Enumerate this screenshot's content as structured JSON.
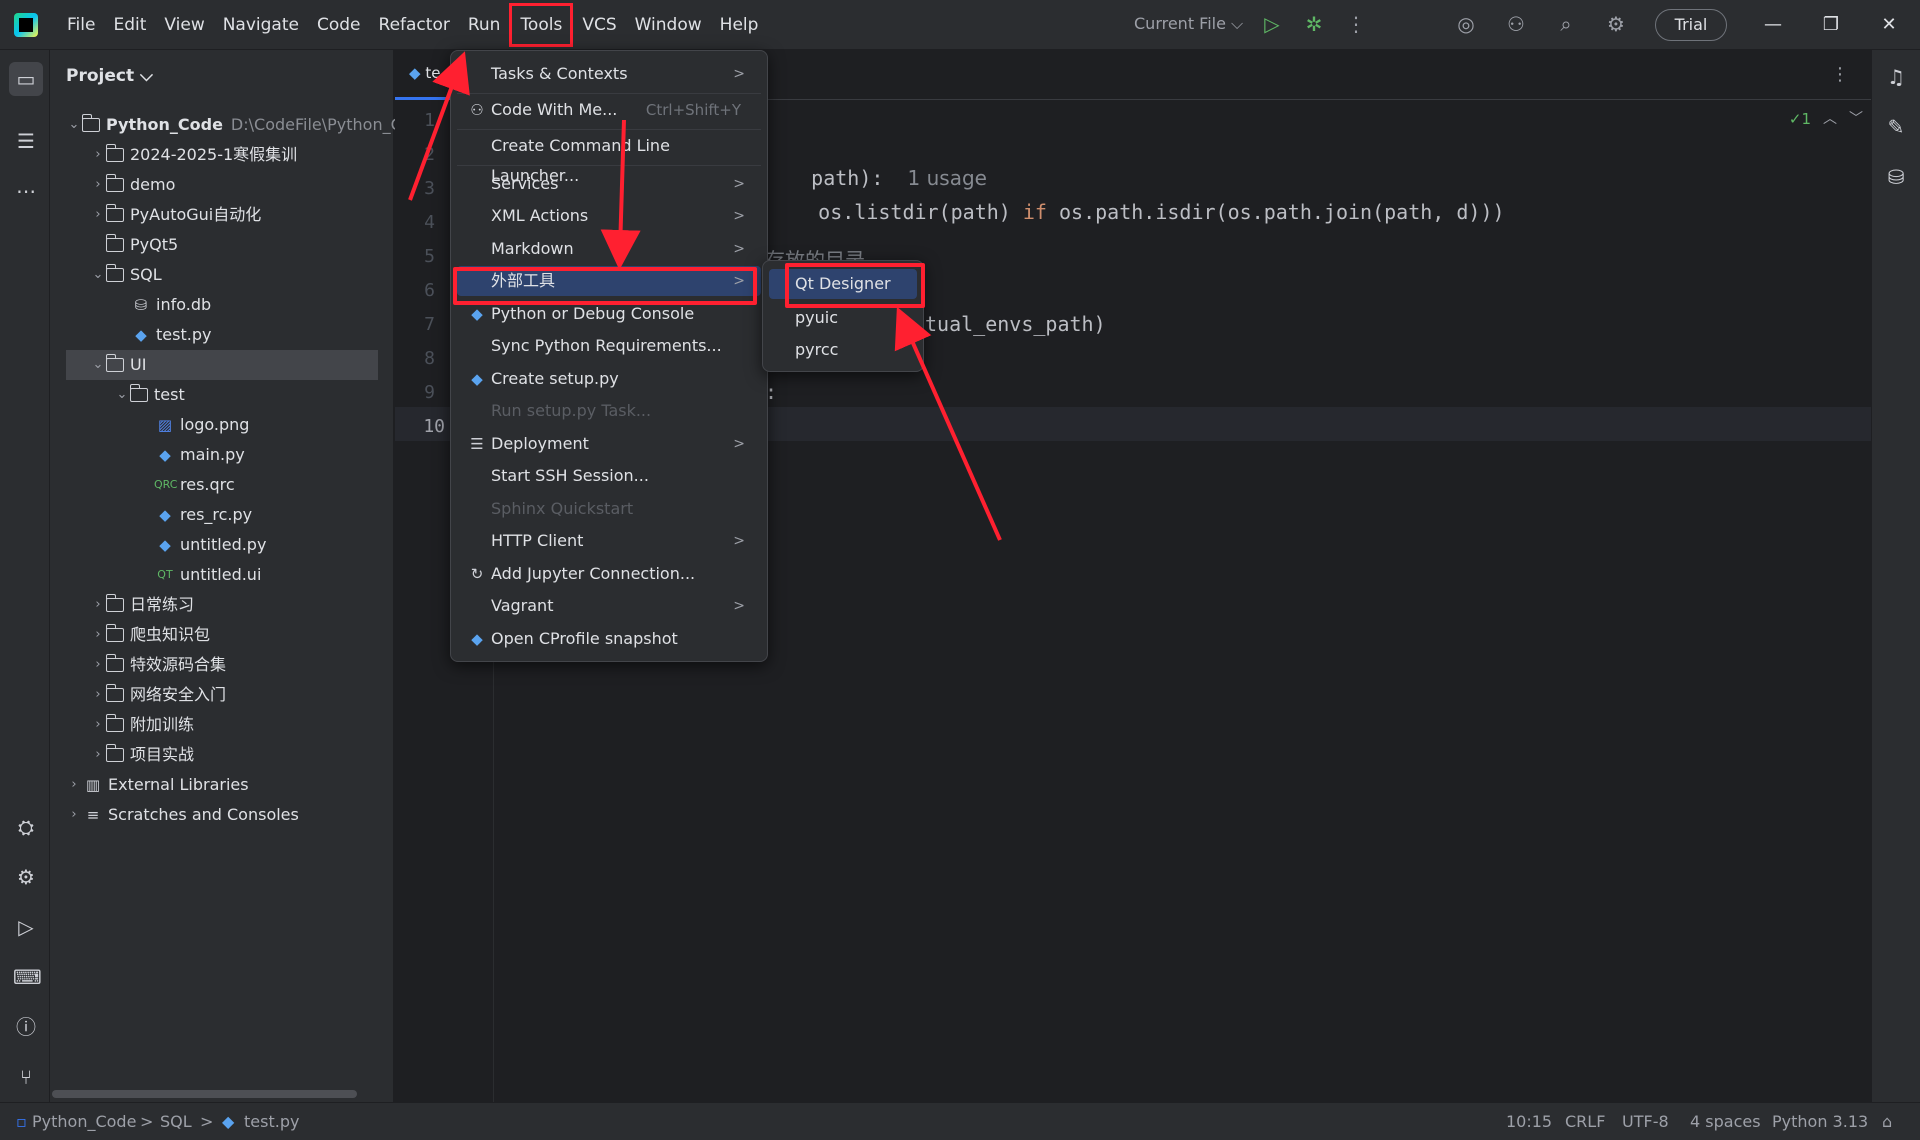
{
  "menubar": {
    "items": [
      "File",
      "Edit",
      "View",
      "Navigate",
      "Code",
      "Refactor",
      "Run",
      "Tools",
      "VCS",
      "Window",
      "Help"
    ]
  },
  "toolbar": {
    "run_config": "Current File ⌵",
    "trial_label": "Trial"
  },
  "project": {
    "header": "Project ⌵",
    "tree": [
      {
        "label": "Python_Code",
        "path": "D:\\CodeFile\\Python_Co"
      },
      {
        "label": "2024-2025-1寒假集训"
      },
      {
        "label": "demo"
      },
      {
        "label": "PyAutoGui自动化"
      },
      {
        "label": "PyQt5"
      },
      {
        "label": "SQL"
      },
      {
        "label": "info.db"
      },
      {
        "label": "test.py"
      },
      {
        "label": "UI"
      },
      {
        "label": "test"
      },
      {
        "label": "logo.png"
      },
      {
        "label": "main.py"
      },
      {
        "label": "res.qrc"
      },
      {
        "label": "res_rc.py"
      },
      {
        "label": "untitled.py"
      },
      {
        "label": "untitled.ui"
      },
      {
        "label": "日常练习"
      },
      {
        "label": "爬虫知识包"
      },
      {
        "label": "特效源码合集"
      },
      {
        "label": "网络安全入门"
      },
      {
        "label": "附加训练"
      },
      {
        "label": "项目实战"
      },
      {
        "label": "External Libraries"
      },
      {
        "label": "Scratches and Consoles"
      }
    ]
  },
  "editor": {
    "tab_label": "te",
    "line_numbers": [
      "1",
      "2",
      "3",
      "4",
      "5",
      "6",
      "7",
      "8",
      "9",
      "10"
    ],
    "code_line2_tail": "path):",
    "code_line2_hint": "1 usage",
    "code_line3_a": "os.listdir(path) ",
    "code_line3_kw": "if",
    "code_line3_b": " os.path.isdir(os.path.join(path, d)))",
    "code_line5_comment": "存放的目录",
    "code_line7": "tual_envs_path)",
    "code_line9": ":",
    "inspection": "✓1"
  },
  "tools_menu": {
    "items": [
      {
        "label": "Tasks & Contexts",
        "submenu": ">"
      },
      {
        "label": "Code With Me...",
        "shortcut": "Ctrl+Shift+Y"
      },
      {
        "label": "Create Command Line Launcher..."
      },
      {
        "label": "Services",
        "submenu": ">"
      },
      {
        "label": "XML Actions",
        "submenu": ">"
      },
      {
        "label": "Markdown",
        "submenu": ">"
      },
      {
        "label": "外部工具",
        "submenu": ">"
      },
      {
        "label": "Python or Debug Console"
      },
      {
        "label": "Sync Python Requirements..."
      },
      {
        "label": "Create setup.py"
      },
      {
        "label": "Run setup.py Task..."
      },
      {
        "label": "Deployment",
        "submenu": ">"
      },
      {
        "label": "Start SSH Session..."
      },
      {
        "label": "Sphinx Quickstart"
      },
      {
        "label": "HTTP Client",
        "submenu": ">"
      },
      {
        "label": "Add Jupyter Connection..."
      },
      {
        "label": "Vagrant",
        "submenu": ">"
      },
      {
        "label": "Open CProfile snapshot"
      }
    ]
  },
  "external_tools_submenu": {
    "items": [
      "Qt Designer",
      "pyuic",
      "pyrcc"
    ]
  },
  "statusbar": {
    "breadcrumb_root": "Python_Code",
    "breadcrumb_sep": ">",
    "breadcrumb_folder": "SQL",
    "breadcrumb_file": "test.py",
    "position": "10:15",
    "line_ending": "CRLF",
    "encoding": "UTF-8",
    "indent": "4 spaces",
    "interpreter": "Python 3.13"
  },
  "colors": {
    "annotation_red": "#ff2030",
    "highlight": "#2e436e",
    "accent": "#3574f0"
  }
}
